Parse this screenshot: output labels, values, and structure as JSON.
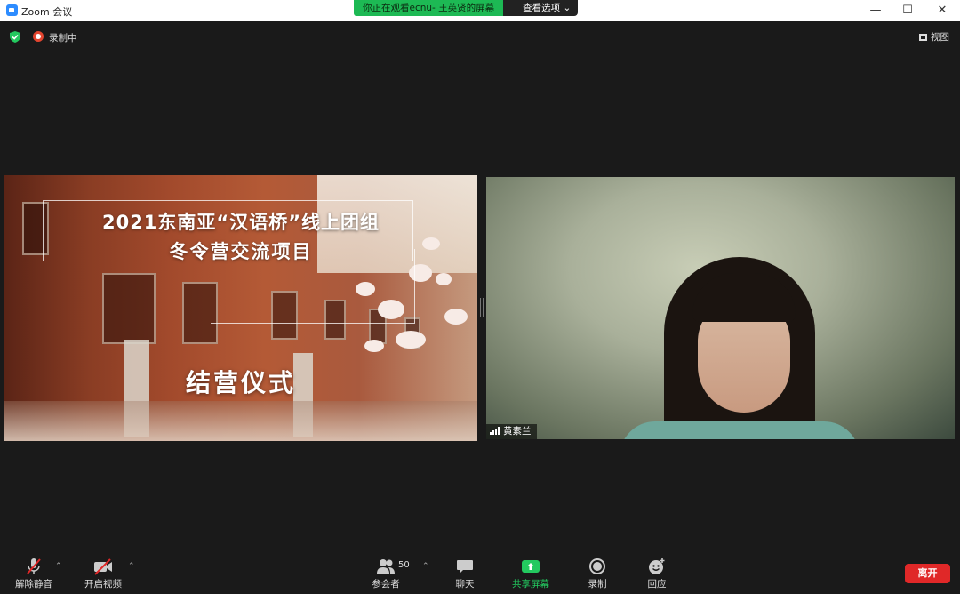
{
  "window": {
    "title": "Zoom 会议",
    "minimize": "—",
    "maximize": "☐",
    "close": "✕"
  },
  "share_banner": {
    "message": "你正在观看ecnu- 王英贤的屏幕",
    "options": "查看选项 ⌄"
  },
  "topbar": {
    "recording": "录制中",
    "view": "视图"
  },
  "slide": {
    "title_line1": "2021东南亚“汉语桥”线上团组",
    "title_line2": "冬令营交流项目",
    "subtitle": "结营仪式"
  },
  "video": {
    "participant_name": "黄素兰"
  },
  "toolbar": {
    "unmute": "解除静音",
    "start_video": "开启视频",
    "participants": "参会者",
    "participant_count": "50",
    "chat": "聊天",
    "share_screen": "共享屏幕",
    "record": "录制",
    "reactions": "回应",
    "leave": "离开"
  },
  "colors": {
    "share_green": "#1db954",
    "leave_red": "#e02828",
    "share_icon_green": "#23c95f"
  }
}
